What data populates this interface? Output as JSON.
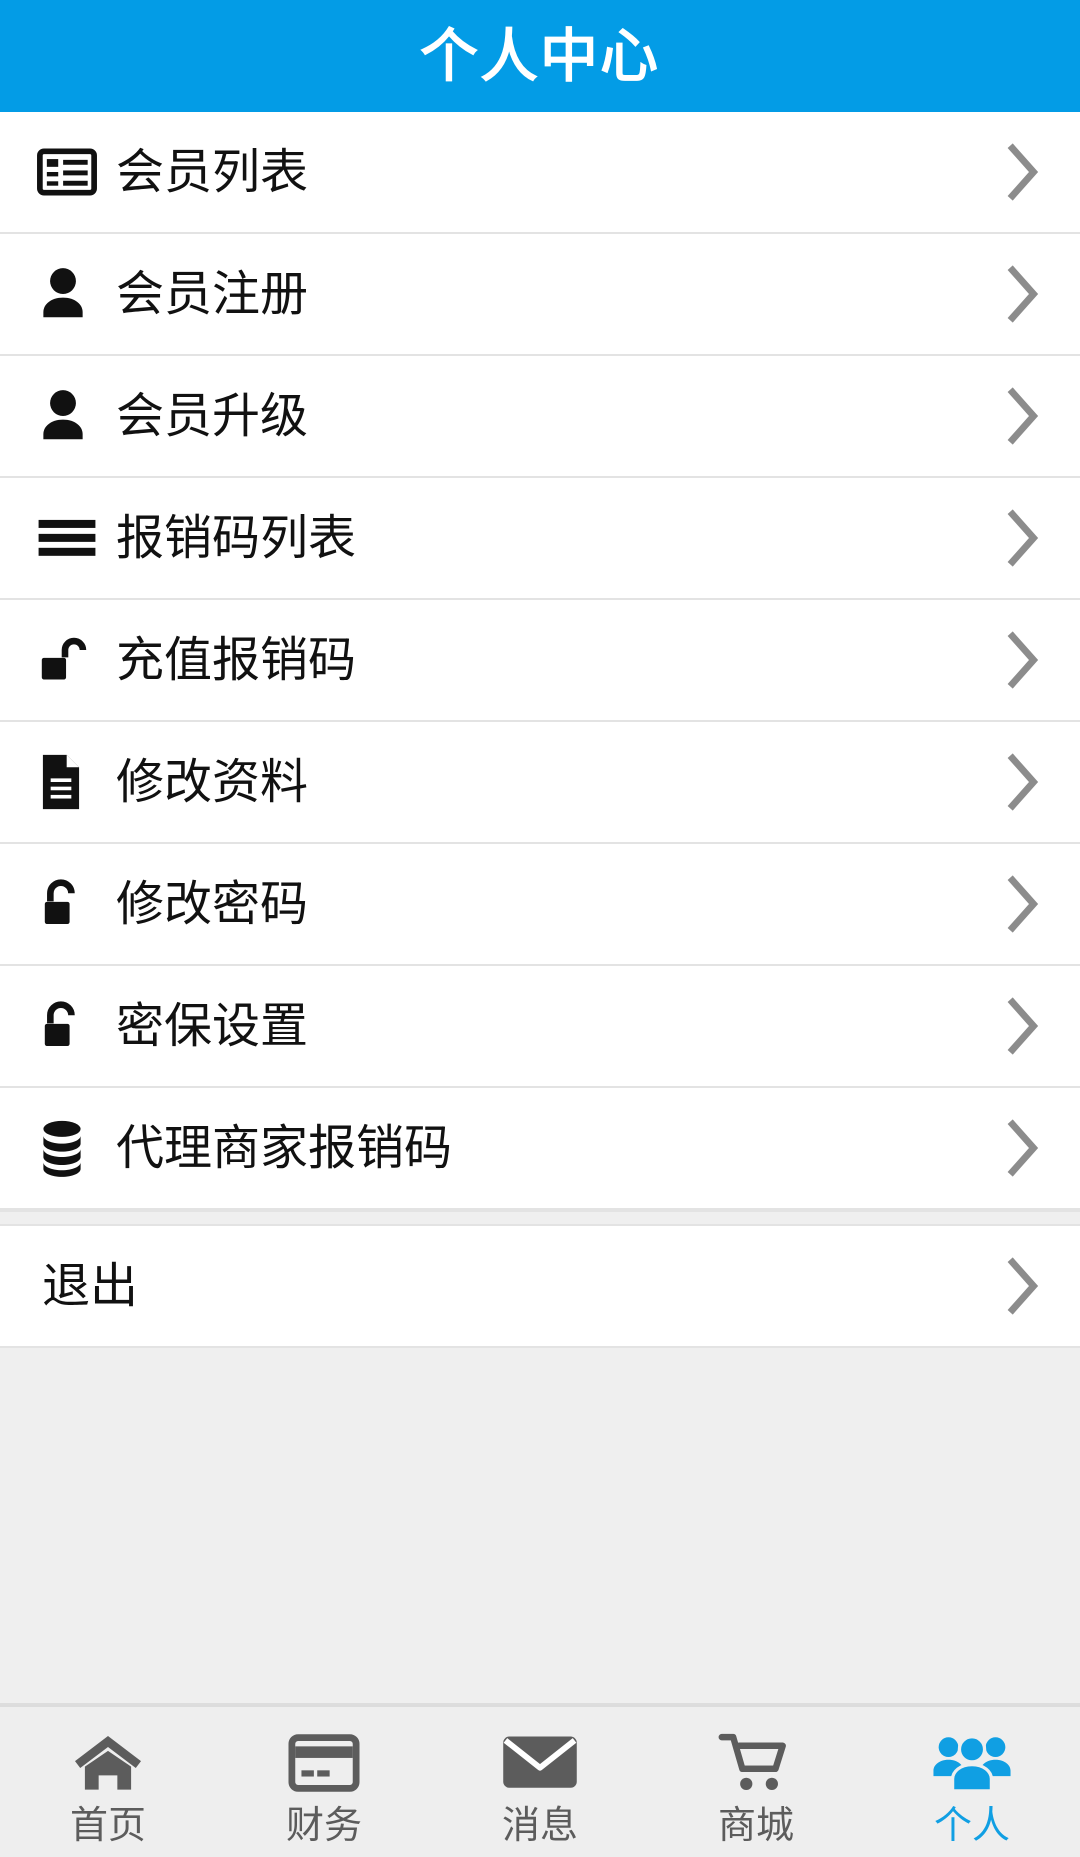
{
  "header": {
    "title": "个人中心",
    "background_color": "#039ce6",
    "text_color": "#ffffff"
  },
  "menu": {
    "items": [
      {
        "label": "会员列表",
        "icon": "list-box-icon",
        "chevron": "chevron-right-icon"
      },
      {
        "label": "会员注册",
        "icon": "person-icon",
        "chevron": "chevron-right-icon"
      },
      {
        "label": "会员升级",
        "icon": "person-icon",
        "chevron": "chevron-right-icon"
      },
      {
        "label": "报销码列表",
        "icon": "bars-icon",
        "chevron": "chevron-right-icon"
      },
      {
        "label": "充值报销码",
        "icon": "unlock-right-icon",
        "chevron": "chevron-right-icon"
      },
      {
        "label": "修改资料",
        "icon": "document-icon",
        "chevron": "chevron-right-icon"
      },
      {
        "label": "修改密码",
        "icon": "lock-open-icon",
        "chevron": "chevron-right-icon"
      },
      {
        "label": "密保设置",
        "icon": "lock-open-icon",
        "chevron": "chevron-right-icon"
      },
      {
        "label": "代理商家报销码",
        "icon": "database-icon",
        "chevron": "chevron-right-icon"
      }
    ],
    "logout": {
      "label": "退出",
      "icon": null,
      "chevron": "chevron-right-icon"
    }
  },
  "tabbar": {
    "active_index": 4,
    "active_color": "#109fe3",
    "inactive_color": "#5c5c5c",
    "items": [
      {
        "label": "首页",
        "icon": "home-icon"
      },
      {
        "label": "财务",
        "icon": "credit-card-icon"
      },
      {
        "label": "消息",
        "icon": "envelope-icon"
      },
      {
        "label": "商城",
        "icon": "shopping-cart-icon"
      },
      {
        "label": "个人",
        "icon": "group-people-icon"
      }
    ]
  }
}
